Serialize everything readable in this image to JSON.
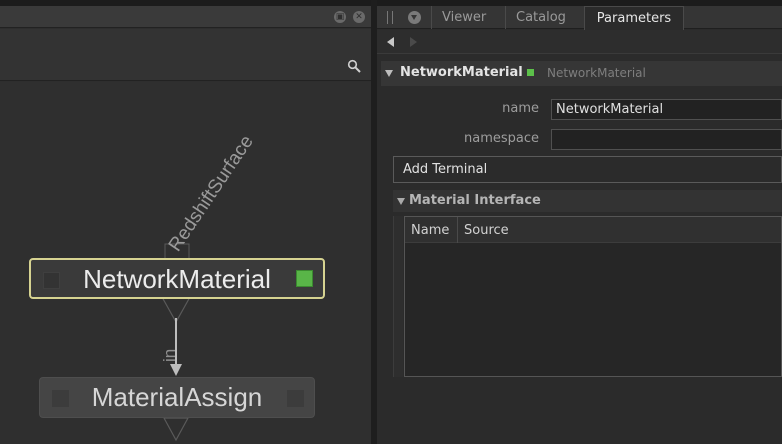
{
  "node_graph": {
    "nodes": [
      {
        "label": "NetworkMaterial",
        "selected": true
      },
      {
        "label": "MaterialAssign",
        "selected": false
      }
    ],
    "connection_labels": {
      "upstream": "RedshiftSurface",
      "downstream": "in"
    },
    "colors": {
      "selected_border": "#d6d391",
      "port_green": "#59b548"
    }
  },
  "tabs": [
    {
      "label": "Viewer",
      "active": false
    },
    {
      "label": "Catalog",
      "active": false
    },
    {
      "label": "Parameters",
      "active": true
    }
  ],
  "parameters": {
    "node_name": "NetworkMaterial",
    "node_type": "NetworkMaterial",
    "fields": [
      {
        "label": "name",
        "value": "NetworkMaterial"
      },
      {
        "label": "namespace",
        "value": ""
      }
    ],
    "add_terminal_label": "Add Terminal",
    "material_interface": {
      "title": "Material Interface",
      "columns": [
        "Name",
        "Source"
      ]
    }
  }
}
